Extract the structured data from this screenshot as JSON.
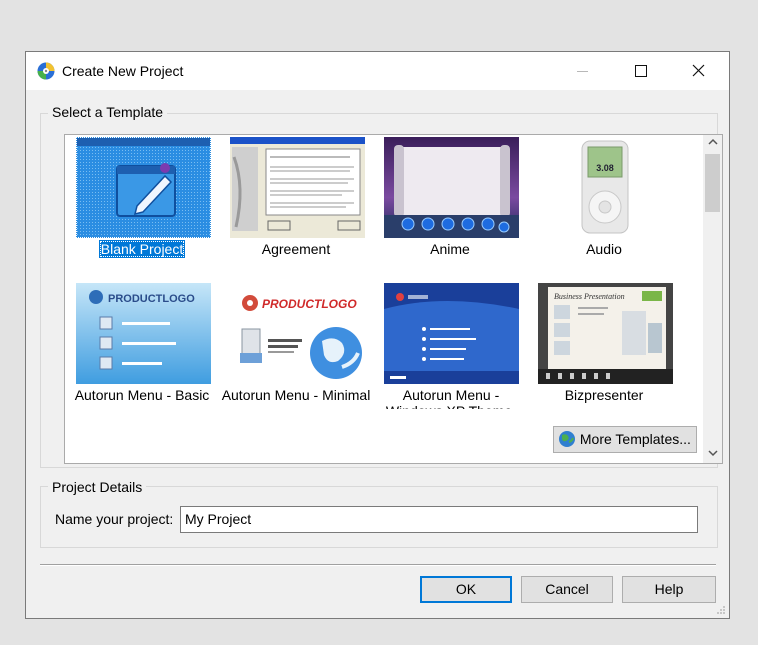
{
  "window": {
    "title": "Create New Project",
    "icon": "cd-disc-icon",
    "controls": [
      "minimize-icon",
      "maximize-icon",
      "close-icon"
    ]
  },
  "template_group": {
    "label": "Select a Template",
    "templates": [
      {
        "label": "Blank Project",
        "selected": true,
        "thumb_text": ""
      },
      {
        "label": "Agreement",
        "selected": false,
        "thumb_text": "HERE ARE THE TERMS OF AGREEMENT"
      },
      {
        "label": "Anime",
        "selected": false,
        "thumb_text": ""
      },
      {
        "label": "Audio",
        "selected": false,
        "thumb_text": "3.08"
      },
      {
        "label": "Autorun Menu - Basic",
        "selected": false,
        "thumb_text": "PRODUCTLOGO"
      },
      {
        "label": "Autorun Menu - Minimal",
        "selected": false,
        "thumb_text": "PRODUCTLOGO"
      },
      {
        "label": "Autorun Menu - Windows XP Theme",
        "selected": false,
        "thumb_text": ""
      },
      {
        "label": "Bizpresenter",
        "selected": false,
        "thumb_text": "Business Presentation"
      }
    ],
    "more_button": "More Templates..."
  },
  "project_details": {
    "label": "Project Details",
    "name_label": "Name your project:",
    "name_value": "My Project"
  },
  "buttons": {
    "ok": "OK",
    "cancel": "Cancel",
    "help": "Help"
  },
  "colors": {
    "selection": "#0078d7",
    "dialog_bg": "#f0f0f0"
  }
}
